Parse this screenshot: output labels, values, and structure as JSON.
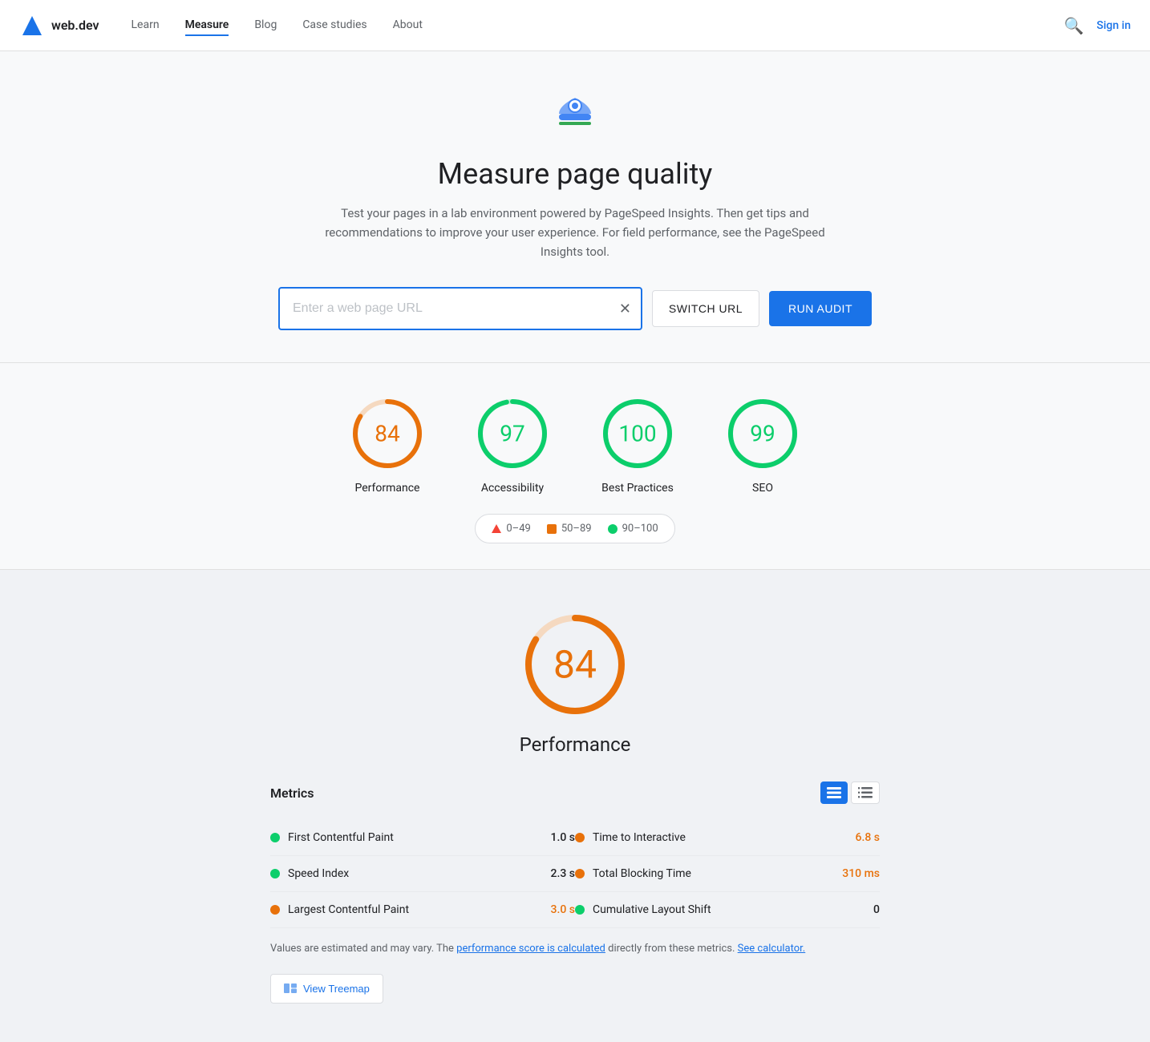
{
  "nav": {
    "logo_text": "web.dev",
    "links": [
      {
        "label": "Learn",
        "active": false
      },
      {
        "label": "Measure",
        "active": true
      },
      {
        "label": "Blog",
        "active": false
      },
      {
        "label": "Case studies",
        "active": false
      },
      {
        "label": "About",
        "active": false
      }
    ],
    "signin_label": "Sign in"
  },
  "hero": {
    "title": "Measure page quality",
    "subtitle": "Test your pages in a lab environment powered by PageSpeed Insights. Then get tips and recommendations to improve your user experience. For field performance, see the PageSpeed Insights tool.",
    "url_placeholder": "Enter a web page URL",
    "switch_url_label": "SWITCH URL",
    "run_audit_label": "RUN AUDIT"
  },
  "scores": [
    {
      "value": 84,
      "label": "Performance",
      "color": "#e8710a",
      "stroke_color": "#e8710a",
      "track_color": "#f5d9c0",
      "pct": 84
    },
    {
      "value": 97,
      "label": "Accessibility",
      "color": "#0cce6b",
      "stroke_color": "#0cce6b",
      "track_color": "#c0f0d8",
      "pct": 97
    },
    {
      "value": 100,
      "label": "Best Practices",
      "color": "#0cce6b",
      "stroke_color": "#0cce6b",
      "track_color": "#c0f0d8",
      "pct": 100
    },
    {
      "value": 99,
      "label": "SEO",
      "color": "#0cce6b",
      "stroke_color": "#0cce6b",
      "track_color": "#c0f0d8",
      "pct": 99
    }
  ],
  "legend": [
    {
      "label": "0–49",
      "type": "triangle",
      "color": "#f44336"
    },
    {
      "label": "50–89",
      "type": "square",
      "color": "#e8710a"
    },
    {
      "label": "90–100",
      "type": "circle",
      "color": "#0cce6b"
    }
  ],
  "performance": {
    "score": 84,
    "title": "Performance",
    "metrics_title": "Metrics",
    "metrics": [
      {
        "name": "First Contentful Paint",
        "value": "1.0 s",
        "dot": "green",
        "value_class": "normal",
        "col": 0
      },
      {
        "name": "Time to Interactive",
        "value": "6.8 s",
        "dot": "orange",
        "value_class": "orange",
        "col": 1
      },
      {
        "name": "Speed Index",
        "value": "2.3 s",
        "dot": "green",
        "value_class": "normal",
        "col": 0
      },
      {
        "name": "Total Blocking Time",
        "value": "310 ms",
        "dot": "orange",
        "value_class": "orange",
        "col": 1
      },
      {
        "name": "Largest Contentful Paint",
        "value": "3.0 s",
        "dot": "orange",
        "value_class": "orange",
        "col": 0
      },
      {
        "name": "Cumulative Layout Shift",
        "value": "0",
        "dot": "green",
        "value_class": "normal",
        "col": 1
      }
    ],
    "note_prefix": "Values are estimated and may vary. The ",
    "note_link1": "performance score is calculated",
    "note_middle": " directly from these metrics. ",
    "note_link2": "See calculator.",
    "treemap_label": "View Treemap"
  }
}
